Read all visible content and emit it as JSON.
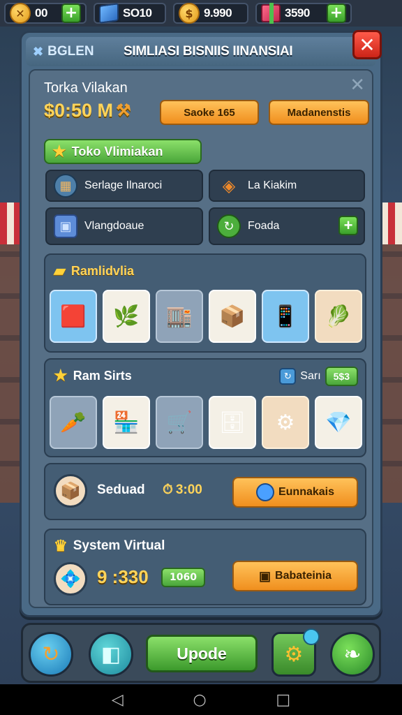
{
  "topbar": {
    "coins": "00",
    "gems": "SO10",
    "gold": "9.990",
    "gifts": "3590",
    "plus": "+"
  },
  "window": {
    "brand": "BGLEN",
    "title": "SIMLIASI BISNIIS IINANSIAI",
    "close": "✕"
  },
  "store": {
    "title": "Torka Vilakan",
    "balance": "$0:50 M",
    "sack_button": "Saoke 165",
    "manage_button": "Madanenstis",
    "close_x": "✕"
  },
  "tab": {
    "label": "Toko Vlimiakan"
  },
  "categories": [
    {
      "label": "Serlage Ilnaroci",
      "icon": "store-icon"
    },
    {
      "label": "La Kiakim",
      "icon": "tag-icon"
    },
    {
      "label": "Vlangdoaue",
      "icon": "box-icon"
    },
    {
      "label": "Foada",
      "icon": "refresh-icon"
    }
  ],
  "panel1": {
    "title": "Ramlidvlia",
    "tiles": [
      "red-box-icon",
      "plant-crate-icon",
      "shop-building-icon",
      "wooden-crate-icon",
      "tablet-box-icon",
      "vegetable-basket-icon"
    ]
  },
  "panel2": {
    "title": "Ram Sirts",
    "badge_label": "Sarı",
    "badge_value": "5$3",
    "tiles": [
      "carrot-icon",
      "shop-box-icon",
      "shopping-cart-icon",
      "storage-box-icon",
      "gear-icon",
      "gem-crate-icon"
    ]
  },
  "row1": {
    "label": "Seduad",
    "timer": "3:00",
    "button": "Eunnakais"
  },
  "row2": {
    "title": "System Virtual",
    "big_value": "9 :330",
    "pill": "1060",
    "button": "Babateinia"
  },
  "bottom_nav": {
    "update": "Upode"
  },
  "colors": {
    "accent_orange": "#f08f1e",
    "accent_green": "#4aa63a",
    "gold_text": "#ffd45a",
    "close_red": "#cc2418"
  }
}
